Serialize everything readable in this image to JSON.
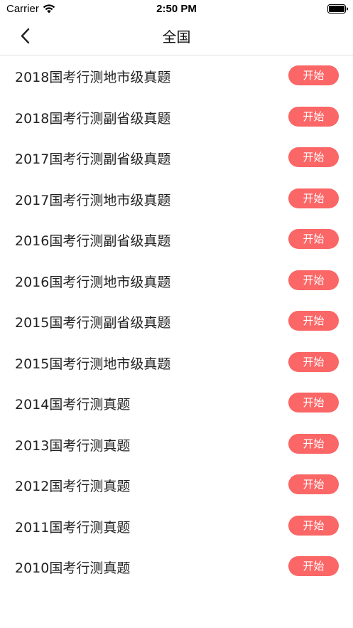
{
  "status_bar": {
    "carrier": "Carrier",
    "time": "2:50 PM"
  },
  "nav": {
    "title": "全国"
  },
  "list": {
    "items": [
      {
        "title": "2018国考行测地市级真题",
        "button": "开始"
      },
      {
        "title": "2018国考行测副省级真题",
        "button": "开始"
      },
      {
        "title": "2017国考行测副省级真题",
        "button": "开始"
      },
      {
        "title": "2017国考行测地市级真题",
        "button": "开始"
      },
      {
        "title": "2016国考行测副省级真题",
        "button": "开始"
      },
      {
        "title": "2016国考行测地市级真题",
        "button": "开始"
      },
      {
        "title": "2015国考行测副省级真题",
        "button": "开始"
      },
      {
        "title": "2015国考行测地市级真题",
        "button": "开始"
      },
      {
        "title": "2014国考行测真题",
        "button": "开始"
      },
      {
        "title": "2013国考行测真题",
        "button": "开始"
      },
      {
        "title": "2012国考行测真题",
        "button": "开始"
      },
      {
        "title": "2011国考行测真题",
        "button": "开始"
      },
      {
        "title": "2010国考行测真题",
        "button": "开始"
      }
    ]
  },
  "colors": {
    "accent": "#fb6666",
    "divider": "#e2e2e2"
  }
}
